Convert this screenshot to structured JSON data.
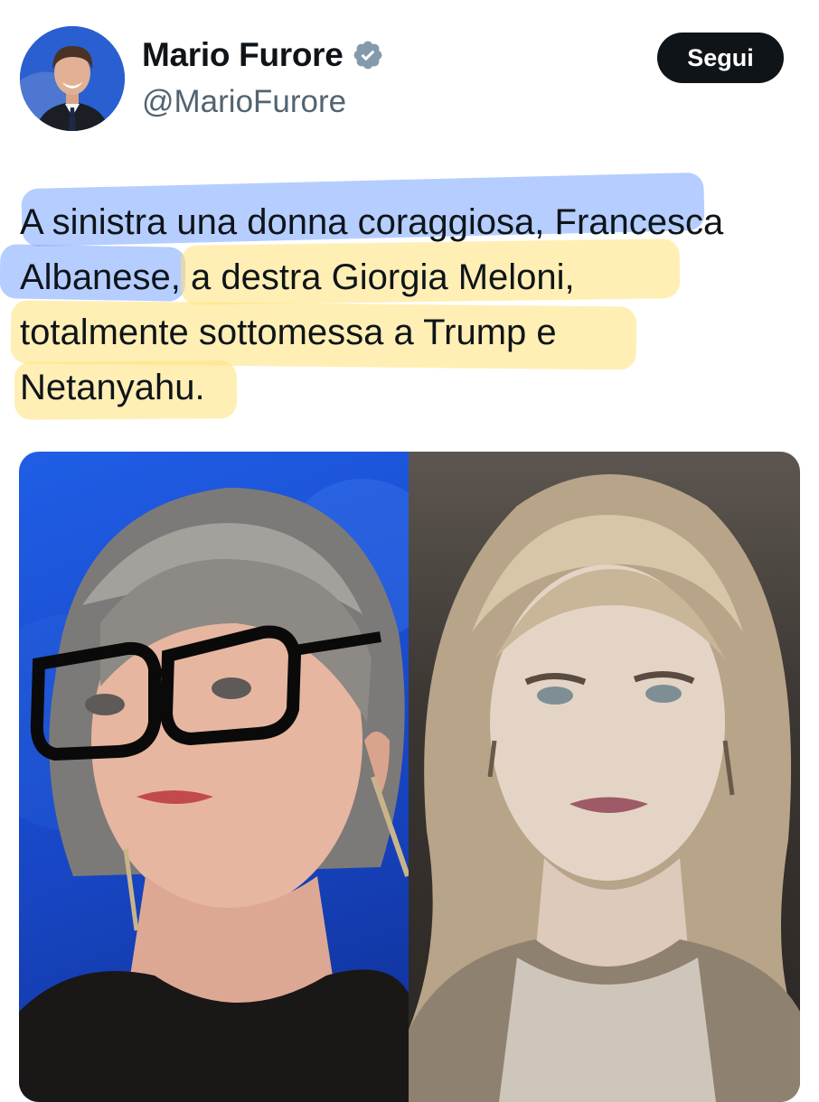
{
  "author": {
    "name": "Mario Furore",
    "handle": "@MarioFurore",
    "verified": true,
    "avatar": "profile-photo"
  },
  "actions": {
    "follow_label": "Segui"
  },
  "tweet": {
    "text": "A sinistra una donna coraggiosa, Francesca\nAlbanese, a destra Giorgia Meloni,\ntotalmente sottomessa a Trump e\nNetanyahu.",
    "highlight_colors": {
      "first_part": "#78a5ff",
      "second_part": "#ffe278"
    }
  },
  "media": {
    "images": [
      {
        "name": "left-photo-woman-with-glasses",
        "background": "#1f5ee6"
      },
      {
        "name": "right-photo-woman-blonde",
        "background": "#3b3632"
      }
    ]
  },
  "colors": {
    "text": "#0f1419",
    "secondary": "#536471",
    "button_bg": "#0f1419",
    "verified_badge": "#829aab"
  }
}
